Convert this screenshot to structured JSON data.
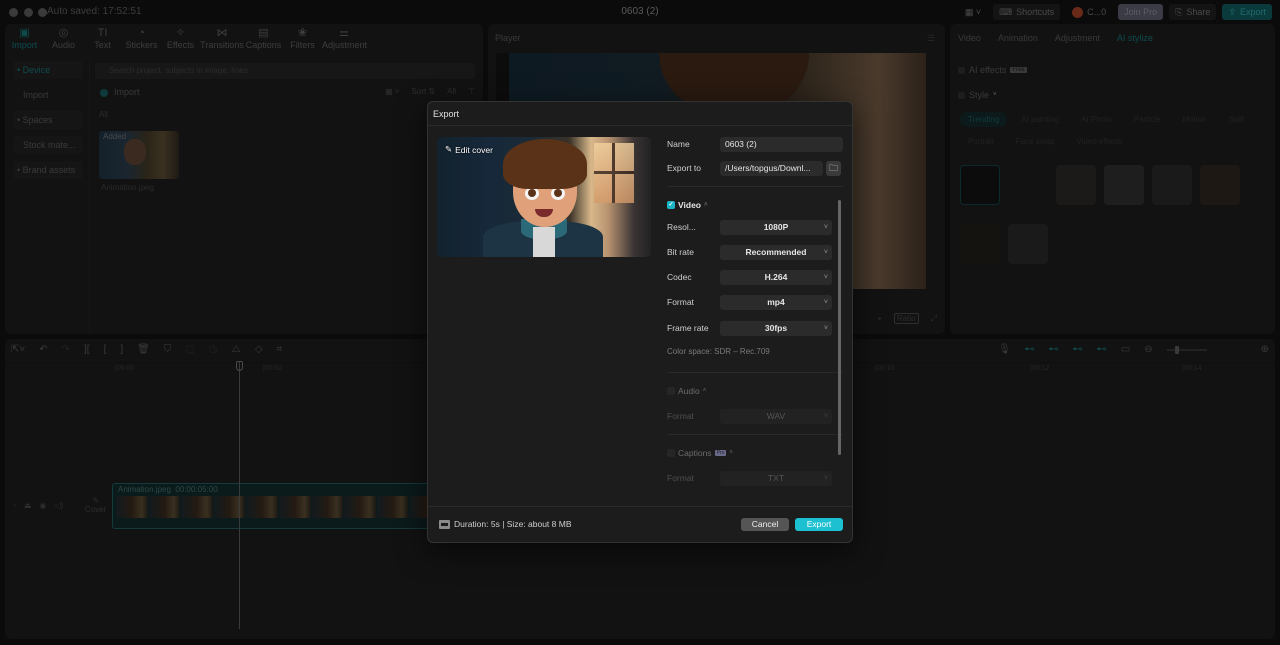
{
  "titlebar": {
    "autosaved": "Auto saved: 17:52:51",
    "title": "0603 (2)",
    "layout_icon": "layout-icon",
    "shortcuts": "Shortcuts",
    "user": "C...0",
    "join_pro": "Join Pro",
    "share": "Share",
    "export": "Export"
  },
  "media": {
    "tools": [
      {
        "label": "Import",
        "icon": "▣",
        "active": true
      },
      {
        "label": "Audio",
        "icon": "◎"
      },
      {
        "label": "Text",
        "icon": "TI"
      },
      {
        "label": "Stickers",
        "icon": "◔"
      },
      {
        "label": "Effects",
        "icon": "✧"
      },
      {
        "label": "Transitions",
        "icon": "⋈"
      },
      {
        "label": "Captions",
        "icon": "▤"
      },
      {
        "label": "Filters",
        "icon": "❀"
      },
      {
        "label": "Adjustment",
        "icon": "⚌"
      }
    ],
    "sidebar": [
      "• Device",
      "Import",
      "• Spaces",
      "Stock mate...",
      "• Brand assets"
    ],
    "search_placeholder": "Search project, subjects in image, lines",
    "import_label": "Import",
    "sort_label": "Sort",
    "all_filter": "All",
    "all_label": "All",
    "item": {
      "badge": "Added",
      "name": "Animation.jpeg"
    }
  },
  "player": {
    "title": "Player",
    "ratio": "Ratio"
  },
  "inspector": {
    "tabs": [
      "Video",
      "Animation",
      "Adjustment",
      "AI stylize"
    ],
    "ai_effects": "AI effects",
    "free_tag": "Free",
    "style": "Style",
    "chips": [
      "Trending",
      "AI painting",
      "AI Photo",
      "Particle",
      "Motion",
      "Split",
      "Portrait",
      "Face swap",
      "Video effects"
    ]
  },
  "timeline": {
    "ticks": [
      "|00:00",
      "|00:02",
      "|00:10",
      "|00:12",
      "|00:14"
    ],
    "clip_name": "Animation.jpeg",
    "clip_duration": "00:00:05:00",
    "cover_label": "Cover"
  },
  "export_dialog": {
    "title": "Export",
    "edit_cover": "Edit cover",
    "name_label": "Name",
    "name_value": "0603 (2)",
    "export_to_label": "Export to",
    "export_to_value": "/Users/topgus/Downl...",
    "video": {
      "label": "Video",
      "checked": true,
      "resolution_label": "Resol...",
      "resolution": "1080P",
      "bitrate_label": "Bit rate",
      "bitrate": "Recommended",
      "codec_label": "Codec",
      "codec": "H.264",
      "format_label": "Format",
      "format": "mp4",
      "framerate_label": "Frame rate",
      "framerate": "30fps",
      "color_space": "Color space: SDR – Rec.709"
    },
    "audio": {
      "label": "Audio",
      "checked": false,
      "format_label": "Format",
      "format": "WAV"
    },
    "captions": {
      "label": "Captions",
      "pro_tag": "Pro",
      "checked": false,
      "format_label": "Format",
      "format": "TXT"
    },
    "footer_info": "Duration: 5s | Size: about 8 MB",
    "cancel": "Cancel",
    "export": "Export"
  },
  "colors": {
    "accent": "#1cc0d0",
    "dialog_bg": "#1c1c1c"
  }
}
